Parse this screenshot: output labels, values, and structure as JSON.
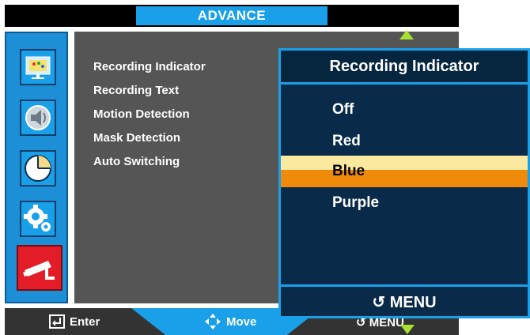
{
  "header": {
    "title": "ADVANCE"
  },
  "sidebar": {
    "items": [
      {
        "icon": "display-settings-icon"
      },
      {
        "icon": "speaker-icon"
      },
      {
        "icon": "clock-icon"
      },
      {
        "icon": "gears-icon"
      },
      {
        "icon": "security-camera-icon",
        "active": true
      }
    ]
  },
  "menu": {
    "items": [
      "Recording Indicator",
      "Recording Text",
      "Motion Detection",
      "Mask Detection",
      "Auto Switching"
    ]
  },
  "popup": {
    "title": "Recording Indicator",
    "options": [
      "Off",
      "Red",
      "Blue",
      "Purple"
    ],
    "selected": "Blue",
    "footer": "MENU"
  },
  "footer": {
    "enter": "Enter",
    "move": "Move",
    "menu": "MENU"
  },
  "colors": {
    "accent": "#1aa0e8",
    "highlight": "#f08a0a",
    "highlight_light": "#fbe9a0",
    "active_tab": "#e21d27",
    "arrow": "#a6e22e"
  }
}
